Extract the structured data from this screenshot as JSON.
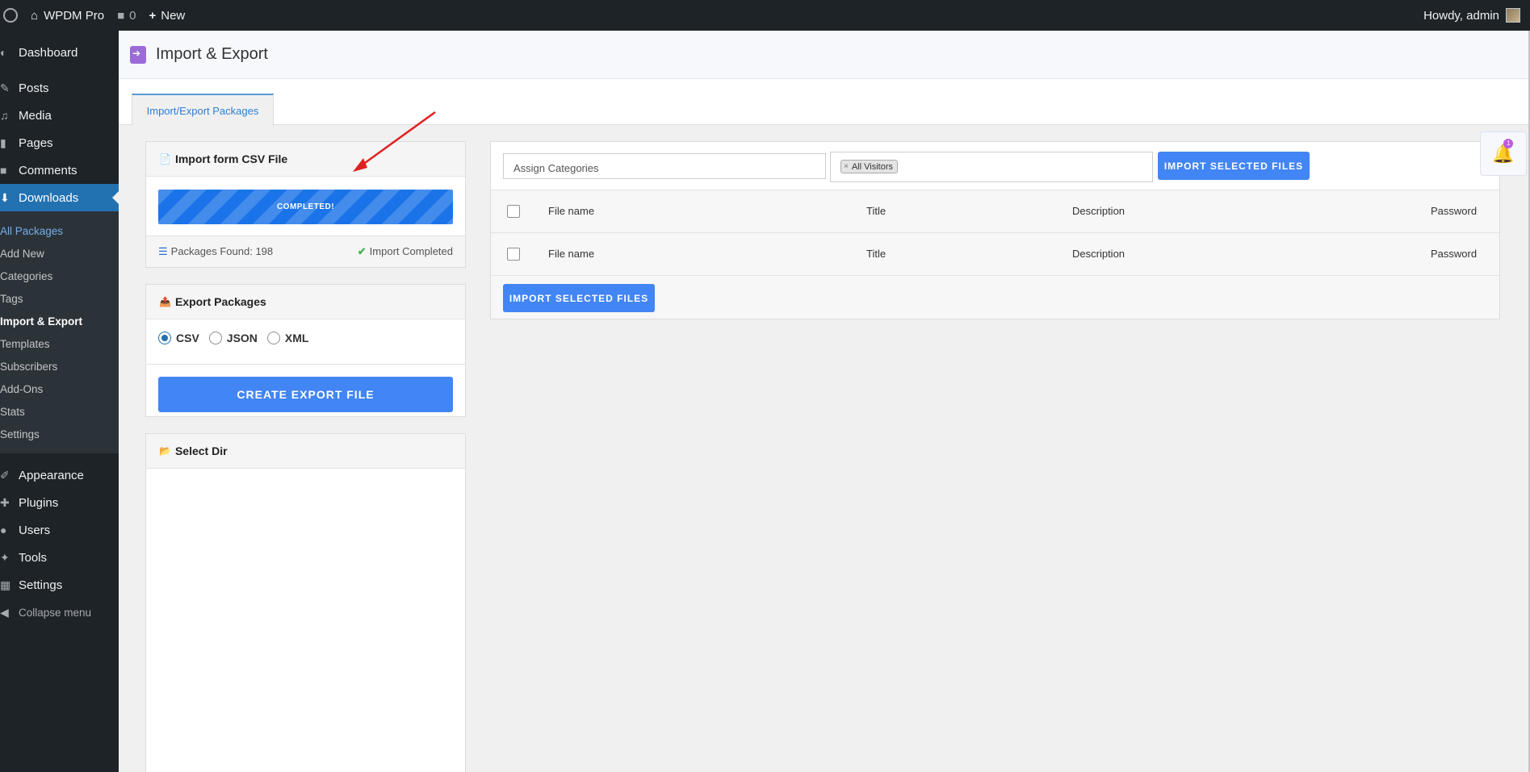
{
  "adminbar": {
    "site_name": "WPDM Pro",
    "comments_count": "0",
    "new_label": "New",
    "howdy": "Howdy, admin"
  },
  "sidebar": {
    "items_top": [
      {
        "label": "Dashboard",
        "icon": "dashboard-icon"
      }
    ],
    "items_main": [
      {
        "label": "Posts",
        "icon": "pin-icon"
      },
      {
        "label": "Media",
        "icon": "media-icon"
      },
      {
        "label": "Pages",
        "icon": "page-icon"
      },
      {
        "label": "Comments",
        "icon": "comment-icon"
      },
      {
        "label": "Downloads",
        "icon": "download-icon"
      }
    ],
    "submenu": [
      {
        "label": "All Packages"
      },
      {
        "label": "Add New"
      },
      {
        "label": "Categories"
      },
      {
        "label": "Tags"
      },
      {
        "label": "Import & Export"
      },
      {
        "label": "Templates"
      },
      {
        "label": "Subscribers"
      },
      {
        "label": "Add-Ons"
      },
      {
        "label": "Stats"
      },
      {
        "label": "Settings"
      }
    ],
    "items_bottom": [
      {
        "label": "Appearance",
        "icon": "brush-icon"
      },
      {
        "label": "Plugins",
        "icon": "plug-icon"
      },
      {
        "label": "Users",
        "icon": "user-icon"
      },
      {
        "label": "Tools",
        "icon": "wrench-icon"
      },
      {
        "label": "Settings",
        "icon": "settings-icon"
      }
    ],
    "collapse_label": "Collapse menu"
  },
  "header": {
    "title": "Import & Export"
  },
  "tabs": [
    {
      "label": "Import/Export Packages"
    }
  ],
  "import_panel": {
    "title": "Import form CSV File",
    "progress_label": "COMPLETED!",
    "progress_value": 1.0,
    "packages_found": "Packages Found: 198",
    "status": "Import Completed"
  },
  "export_panel": {
    "title": "Export Packages",
    "formats": [
      "CSV",
      "JSON",
      "XML"
    ],
    "selected_format": "CSV",
    "button_label": "CREATE EXPORT FILE"
  },
  "dir_panel": {
    "title": "Select Dir"
  },
  "files_panel": {
    "assign_placeholder": "Assign Categories",
    "access_chip": "All Visitors",
    "import_button": "IMPORT SELECTED FILES",
    "columns": [
      "File name",
      "Title",
      "Description",
      "Password"
    ],
    "footer_columns": [
      "File name",
      "Title",
      "Description",
      "Password"
    ]
  },
  "notification": {
    "count": "1"
  },
  "colors": {
    "admin_dark": "#1d2327",
    "wp_blue": "#2271b1",
    "button_blue": "#4285f4",
    "progress_blue": "#1a73e8",
    "annotation_red": "#e02020"
  }
}
